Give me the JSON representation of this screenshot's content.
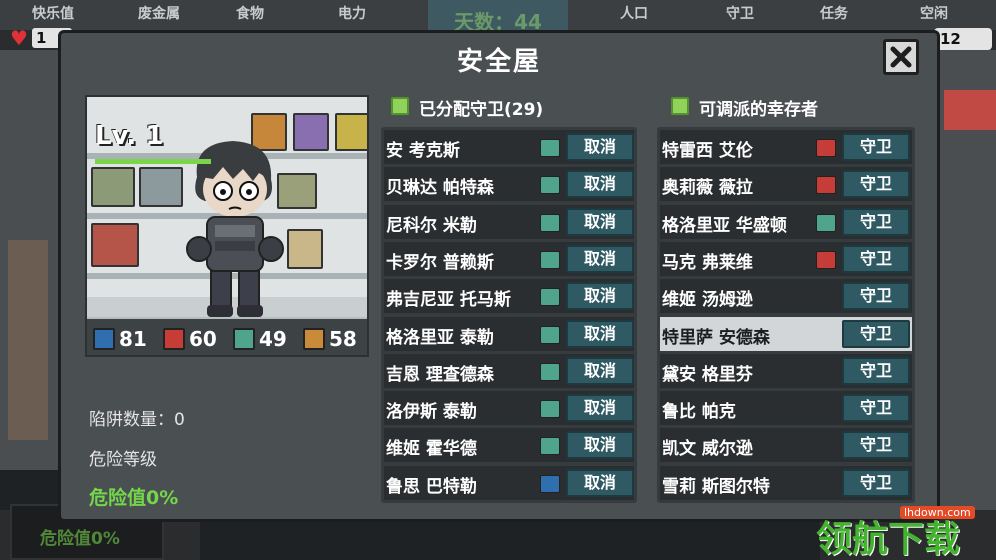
{
  "hud": {
    "labels": [
      "快乐值",
      "废金属",
      "食物",
      "电力",
      "人口",
      "守卫",
      "任务",
      "空闲"
    ],
    "days": "天数：44",
    "happiness_value": "1",
    "population_value": "12"
  },
  "background": {
    "danger_text": "危险值0%"
  },
  "dialog": {
    "title": "安全屋",
    "close_icon": "close-x-icon"
  },
  "character": {
    "level": "Lv. 1",
    "stats": [
      {
        "icon": "armor-icon",
        "color": "#2f6fb0",
        "value": "81"
      },
      {
        "icon": "pistol-icon",
        "color": "#c53d36",
        "value": "60"
      },
      {
        "icon": "rifle-icon",
        "color": "#4fa48c",
        "value": "49"
      },
      {
        "icon": "supply-icon",
        "color": "#c98a3a",
        "value": "58"
      }
    ],
    "traps": "陷阱数量：0",
    "danger_level": "危险等级",
    "danger_value": "危险值0%"
  },
  "assigned": {
    "header": "已分配守卫(29)",
    "button_label": "取消",
    "rows": [
      {
        "name": "安 考克斯",
        "weapon": "rifle"
      },
      {
        "name": "贝琳达 帕特森",
        "weapon": "rifle"
      },
      {
        "name": "尼科尔 米勒",
        "weapon": "rifle"
      },
      {
        "name": "卡罗尔 普赖斯",
        "weapon": "rifle"
      },
      {
        "name": "弗吉尼亚 托马斯",
        "weapon": "rifle"
      },
      {
        "name": "格洛里亚 泰勒",
        "weapon": "rifle"
      },
      {
        "name": "吉恩 理查德森",
        "weapon": "rifle"
      },
      {
        "name": "洛伊斯 泰勒",
        "weapon": "rifle"
      },
      {
        "name": "维姬 霍华德",
        "weapon": "rifle"
      },
      {
        "name": "鲁思 巴特勒",
        "weapon": "melee"
      }
    ]
  },
  "available": {
    "header": "可调派的幸存者",
    "button_label": "守卫",
    "rows": [
      {
        "name": "特雷西 艾伦",
        "weapon": "pistol"
      },
      {
        "name": "奥莉薇 薇拉",
        "weapon": "pistol"
      },
      {
        "name": "格洛里亚 华盛顿",
        "weapon": "rifle"
      },
      {
        "name": "马克 弗莱维",
        "weapon": "pistol"
      },
      {
        "name": "维姬 汤姆逊",
        "weapon": ""
      },
      {
        "name": "特里萨 安德森",
        "weapon": "",
        "selected": true
      },
      {
        "name": "黛安 格里芬",
        "weapon": ""
      },
      {
        "name": "鲁比 帕克",
        "weapon": ""
      },
      {
        "name": "凯文 威尔逊",
        "weapon": ""
      },
      {
        "name": "雪莉 斯图尔特",
        "weapon": ""
      }
    ]
  },
  "watermark": {
    "url": "lhdown.com",
    "logo": "领航下载"
  }
}
